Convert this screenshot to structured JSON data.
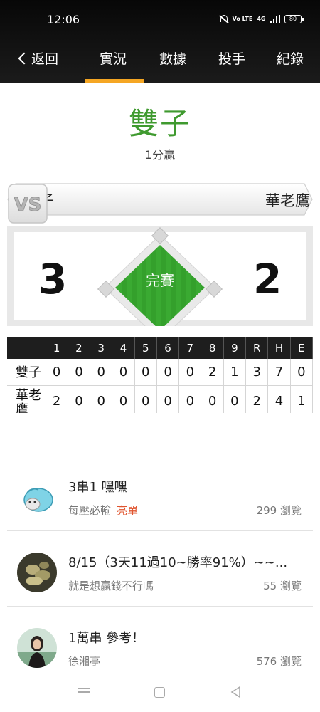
{
  "status_bar": {
    "time": "12:06",
    "network": "4G",
    "volte": "Vo LTE",
    "battery": "80"
  },
  "nav": {
    "back_label": "返回",
    "tabs": [
      {
        "label": "實況",
        "active": true
      },
      {
        "label": "數據",
        "active": false
      },
      {
        "label": "投手",
        "active": false
      },
      {
        "label": "紀錄",
        "active": false
      }
    ],
    "accent": "#f5a623"
  },
  "result": {
    "winner": "雙子",
    "margin": "1分贏",
    "winner_color": "#3f9a2f"
  },
  "teams": {
    "away": "雙子",
    "home": "華老鷹",
    "vs": "VS"
  },
  "score": {
    "away": "3",
    "home": "2",
    "status": "完賽",
    "field_color": "#3aaa32"
  },
  "linescore": {
    "headers": [
      "",
      "1",
      "2",
      "3",
      "4",
      "5",
      "6",
      "7",
      "8",
      "9",
      "R",
      "H",
      "E"
    ],
    "rows": [
      [
        "雙子",
        "0",
        "0",
        "0",
        "0",
        "0",
        "0",
        "0",
        "2",
        "1",
        "3",
        "7",
        "0"
      ],
      [
        "華老鷹",
        "2",
        "0",
        "0",
        "0",
        "0",
        "0",
        "0",
        "0",
        "0",
        "2",
        "4",
        "1"
      ]
    ]
  },
  "posts": [
    {
      "title": "3串1  嘿嘿",
      "author": "每壓必輸",
      "tag": "亮單",
      "views": "299 瀏覽",
      "avatar_icon": "seal-mascot-icon"
    },
    {
      "title": "8/15（3天11過10~勝率91%）~~...",
      "author": "就是想贏錢不行嗎",
      "tag": "",
      "views": "55 瀏覽",
      "avatar_icon": "photo-avatar-icon"
    },
    {
      "title": "1萬串 參考！",
      "author": "徐湘亭",
      "tag": "",
      "views": "576 瀏覽",
      "avatar_icon": "person-avatar-icon"
    }
  ],
  "system_nav": {
    "icons": [
      "menu-icon",
      "home-icon",
      "back-icon"
    ]
  }
}
